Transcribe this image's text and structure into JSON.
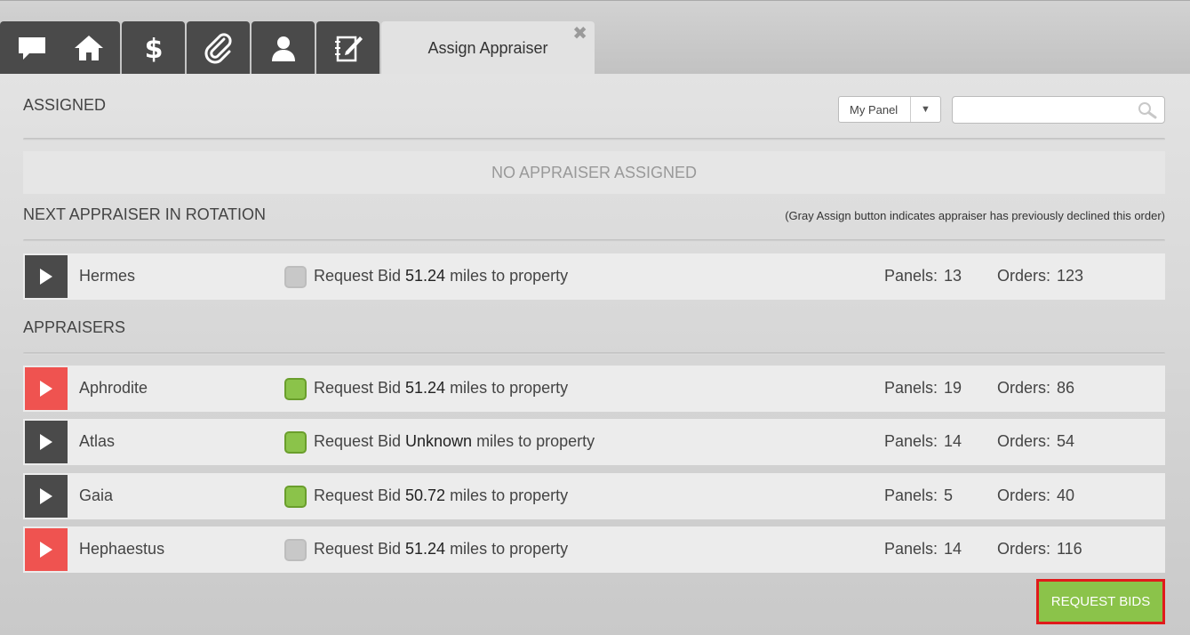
{
  "tabs": {
    "icons": [
      "chat-icon",
      "home-icon",
      "dollar-icon",
      "paperclip-icon",
      "user-icon",
      "notes-icon"
    ],
    "active_label": "Assign Appraiser",
    "close_glyph": "✖"
  },
  "assigned": {
    "title": "ASSIGNED",
    "filter_value": "My Panel",
    "search_placeholder": "",
    "empty_text": "NO APPRAISER ASSIGNED"
  },
  "rotation": {
    "title": "NEXT APPRAISER IN ROTATION",
    "note": "(Gray Assign button indicates appraiser has previously declined this order)",
    "rows": [
      {
        "name": "Hermes",
        "button_color": "dark",
        "bid_checked": false,
        "request_label": "Request Bid",
        "distance": "51.24",
        "distance_suffix": "miles to property",
        "panels_label": "Panels:",
        "panels": "13",
        "orders_label": "Orders:",
        "orders": "123"
      }
    ]
  },
  "appraisers": {
    "title": "APPRAISERS",
    "rows": [
      {
        "name": "Aphrodite",
        "button_color": "red",
        "bid_checked": true,
        "request_label": "Request Bid",
        "distance": "51.24",
        "distance_suffix": "miles to property",
        "panels_label": "Panels:",
        "panels": "19",
        "orders_label": "Orders:",
        "orders": "86"
      },
      {
        "name": "Atlas",
        "button_color": "dark",
        "bid_checked": true,
        "request_label": "Request Bid",
        "distance": "Unknown",
        "distance_suffix": "miles to property",
        "panels_label": "Panels:",
        "panels": "14",
        "orders_label": "Orders:",
        "orders": "54"
      },
      {
        "name": "Gaia",
        "button_color": "dark",
        "bid_checked": true,
        "request_label": "Request Bid",
        "distance": "50.72",
        "distance_suffix": "miles to property",
        "panels_label": "Panels:",
        "panels": "5",
        "orders_label": "Orders:",
        "orders": "40"
      },
      {
        "name": "Hephaestus",
        "button_color": "red",
        "bid_checked": false,
        "request_label": "Request Bid",
        "distance": "51.24",
        "distance_suffix": "miles to property",
        "panels_label": "Panels:",
        "panels": "14",
        "orders_label": "Orders:",
        "orders": "116"
      }
    ]
  },
  "actions": {
    "request_bids_label": "REQUEST BIDS"
  },
  "colors": {
    "accent_green": "#8bc34a",
    "declined_red": "#ef5350",
    "dark_button": "#4a4a4a",
    "highlight_border": "#e01b1b"
  }
}
